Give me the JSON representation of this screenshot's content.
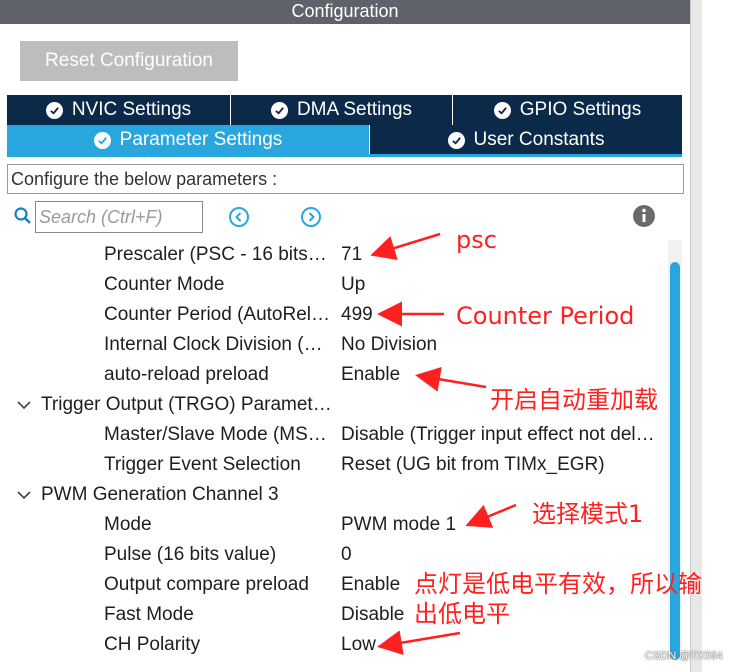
{
  "window": {
    "title": "Configuration"
  },
  "toolbar": {
    "reset_label": "Reset Configuration"
  },
  "tabs": {
    "row1": [
      "NVIC Settings",
      "DMA Settings",
      "GPIO Settings"
    ],
    "row2": [
      "Parameter Settings",
      "User Constants"
    ],
    "active": "Parameter Settings"
  },
  "config_hint": "Configure the below parameters :",
  "search": {
    "placeholder": "Search (Ctrl+F)"
  },
  "params": {
    "prescaler": {
      "label": "Prescaler (PSC - 16 bits…",
      "value": "71"
    },
    "counter_mode": {
      "label": "Counter Mode",
      "value": "Up"
    },
    "counter_period": {
      "label": "Counter Period (AutoRel…",
      "value": "499"
    },
    "clock_division": {
      "label": "Internal Clock Division (…",
      "value": "No Division"
    },
    "autoreload": {
      "label": "auto-reload preload",
      "value": "Enable"
    },
    "trgo_group": {
      "label": "Trigger Output (TRGO) Paramet…"
    },
    "master_slave": {
      "label": "Master/Slave Mode (MS…",
      "value": "Disable (Trigger input effect not del…"
    },
    "trigger_event": {
      "label": "Trigger Event Selection",
      "value": "Reset (UG bit from TIMx_EGR)"
    },
    "pwm_group": {
      "label": "PWM Generation Channel 3"
    },
    "mode": {
      "label": "Mode",
      "value": "PWM mode 1"
    },
    "pulse": {
      "label": "Pulse (16 bits value)",
      "value": "0"
    },
    "oc_preload": {
      "label": "Output compare preload",
      "value": "Enable"
    },
    "fast_mode": {
      "label": "Fast Mode",
      "value": "Disable"
    },
    "ch_polarity": {
      "label": "CH Polarity",
      "value": "Low"
    }
  },
  "annotations": {
    "psc": "psc",
    "counter_period": "Counter Period",
    "autoreload": "开启自动重加载",
    "mode": "选择模式1",
    "polarity_line1": "点灯是低电平有效，所以输",
    "polarity_line2": "出低电平"
  },
  "watermark": "CSDN @TX564",
  "colors": {
    "titlebar": "#5f6369",
    "tab_dark": "#0b2a4a",
    "tab_active": "#2aa6df",
    "annotation": "#ff2020"
  }
}
